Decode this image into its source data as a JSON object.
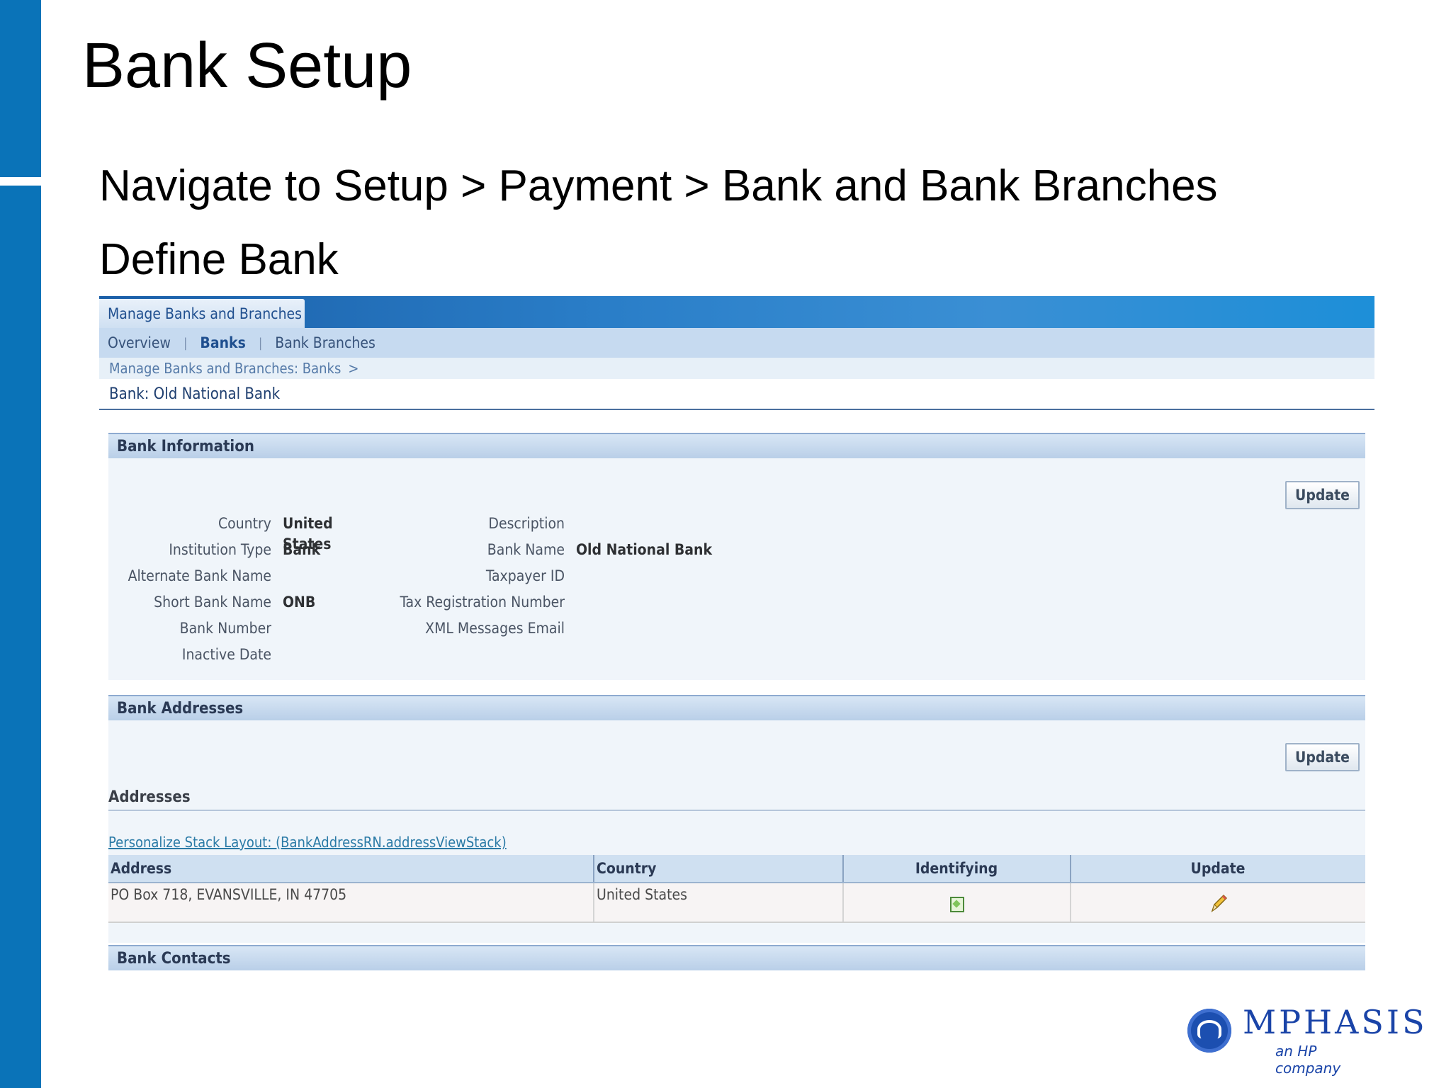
{
  "slide": {
    "title": "Bank Setup",
    "navigation": "Navigate to Setup > Payment > Bank and Bank Branches",
    "subtitle": "Define Bank"
  },
  "app": {
    "header_tab": "Manage Banks and Branches",
    "subnav": {
      "overview": "Overview",
      "sep": "|",
      "banks": "Banks",
      "branches": "Bank Branches"
    },
    "breadcrumb": {
      "text": "Manage Banks and Branches: Banks",
      "arrow": ">"
    },
    "page_title": "Bank: Old National Bank"
  },
  "bank_info": {
    "title": "Bank Information",
    "update_label": "Update",
    "left_fields": [
      {
        "label": "Country",
        "value": "United States"
      },
      {
        "label": "Institution Type",
        "value": "Bank"
      },
      {
        "label": "Alternate Bank Name",
        "value": ""
      },
      {
        "label": "Short Bank Name",
        "value": "ONB"
      },
      {
        "label": "Bank Number",
        "value": ""
      },
      {
        "label": "Inactive Date",
        "value": ""
      }
    ],
    "right_fields": [
      {
        "label": "Description",
        "value": ""
      },
      {
        "label": "Bank Name",
        "value": "Old National Bank"
      },
      {
        "label": "Taxpayer ID",
        "value": ""
      },
      {
        "label": "Tax Registration Number",
        "value": ""
      },
      {
        "label": "XML Messages Email",
        "value": ""
      }
    ]
  },
  "bank_addresses": {
    "title": "Bank Addresses",
    "update_label": "Update",
    "addresses_label": "Addresses",
    "personalize_link": "Personalize Stack Layout: (BankAddressRN.addressViewStack)",
    "columns": [
      "Address",
      "Country",
      "Identifying",
      "Update"
    ],
    "rows": [
      {
        "address": "PO Box 718, EVANSVILLE, IN 47705",
        "country": "United States",
        "identifying_icon": "identifying-checkbox-icon",
        "update_icon": "pencil-icon"
      }
    ]
  },
  "bank_contacts": {
    "title": "Bank Contacts"
  },
  "logo": {
    "name": "MPHASIS",
    "tagline": "an HP company"
  },
  "colors": {
    "accent_bar": "#0a73b8",
    "header_blue": "#1b5fa8",
    "link": "#2a7aa6"
  }
}
